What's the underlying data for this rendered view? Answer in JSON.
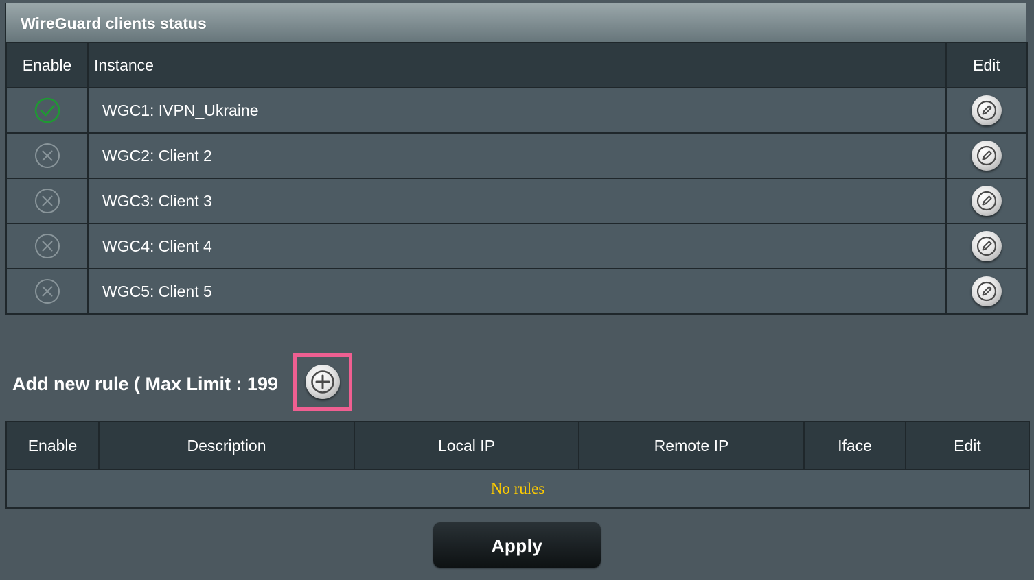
{
  "status_panel": {
    "title": "WireGuard clients status",
    "headers": {
      "enable": "Enable",
      "instance": "Instance",
      "edit": "Edit"
    },
    "clients": [
      {
        "instance": "WGC1: IVPN_Ukraine",
        "enabled": true,
        "status_icon": "check-circle-icon"
      },
      {
        "instance": "WGC2: Client 2",
        "enabled": false,
        "status_icon": "x-circle-icon"
      },
      {
        "instance": "WGC3: Client 3",
        "enabled": false,
        "status_icon": "x-circle-icon"
      },
      {
        "instance": "WGC4: Client 4",
        "enabled": false,
        "status_icon": "x-circle-icon"
      },
      {
        "instance": "WGC5: Client 5",
        "enabled": false,
        "status_icon": "x-circle-icon"
      }
    ]
  },
  "add_rule": {
    "label": "Add new rule ( Max Limit : 199",
    "button_icon": "plus-circle-icon",
    "highlight_color": "#ef5f91"
  },
  "rules_table": {
    "headers": {
      "enable": "Enable",
      "description": "Description",
      "local_ip": "Local IP",
      "remote_ip": "Remote IP",
      "iface": "Iface",
      "edit": "Edit"
    },
    "empty_message": "No rules",
    "empty_message_color": "#ffcc00"
  },
  "apply_button": {
    "label": "Apply"
  },
  "colors": {
    "page_bg": "#4c585f",
    "header_bg": "#2e3a40",
    "row_bg": "#4d5b63",
    "enabled_green": "#1e9a32",
    "disabled_gray": "#8a969b"
  }
}
